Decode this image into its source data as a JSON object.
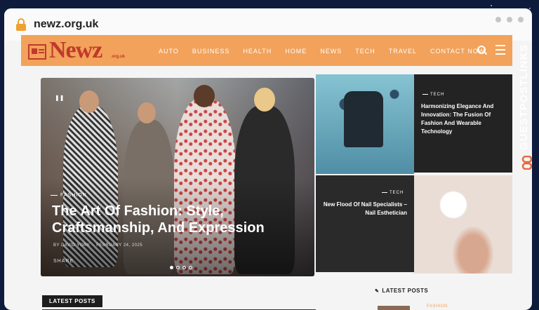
{
  "browser": {
    "url": "newz.org.uk"
  },
  "site": {
    "logo": "Newz",
    "logo_sub": ".org.uk",
    "nav": [
      "AUTO",
      "BUSINESS",
      "HEALTH",
      "HOME",
      "NEWS",
      "TECH",
      "TRAVEL",
      "CONTACT NOW"
    ]
  },
  "hero": {
    "category": "FASHION",
    "title": "The Art Of Fashion: Style, Craftsmanship, And Expression",
    "author": "BY DAVID YORK",
    "date": "FEBRUARY 24, 2025",
    "share": "SHARE"
  },
  "tiles": [
    {
      "category": "TECH",
      "title": "Harmonizing Elegance And Innovation: The Fusion Of Fashion And Wearable Technology"
    },
    {
      "category": "TECH",
      "title": "New Flood Of Nail Specialists – Nail Esthetician"
    }
  ],
  "latest": {
    "label": "LATEST POSTS",
    "side_label": "LATEST POSTS",
    "side_category": "FASHION"
  },
  "watermark": "GUESTPOSTLINKS",
  "colors": {
    "accent": "#f2a25a",
    "brand": "#c0392b"
  }
}
